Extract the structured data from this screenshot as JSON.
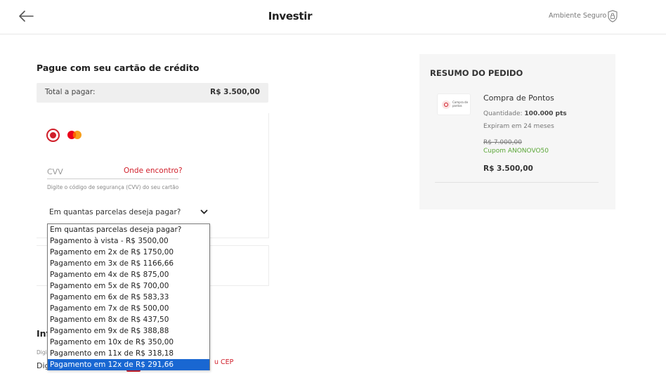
{
  "header": {
    "title": "Investir",
    "secure_label": "Ambiente Seguro",
    "back_icon": "arrow-left-icon",
    "lock_icon": "lock-icon"
  },
  "payment": {
    "title": "Pague com seu cartão de crédito",
    "total_label": "Total a pagar:",
    "total_value": "R$ 3.500,00",
    "card_brand": "mastercard-icon",
    "cvv_placeholder": "CVV",
    "cvv_help_link": "Onde encontro?",
    "cvv_hint": "Digite o código de segurança (CVV) do seu cartão",
    "installments_select_value": "Em quantas parcelas deseja pagar?",
    "installments_options": [
      "Em quantas parcelas deseja pagar?",
      "Pagamento à vista - R$ 3500,00",
      "Pagamento em 2x de R$ 1750,00",
      "Pagamento em 3x de R$ 1166,66",
      "Pagamento em 4x de R$ 875,00",
      "Pagamento em 5x de R$ 700,00",
      "Pagamento em 6x de R$ 583,33",
      "Pagamento em 7x de R$ 500,00",
      "Pagamento em 8x de R$ 437,50",
      "Pagamento em 9x de R$ 388,88",
      "Pagamento em 10x de R$ 350,00",
      "Pagamento em 11x de R$ 318,18",
      "Pagamento em 12x de R$ 291,66"
    ],
    "highlighted_option_index": 12
  },
  "info_section": {
    "heading": "Inf",
    "small_label": "Digi",
    "cep_value": "Dig",
    "cep_link": "u CEP"
  },
  "summary": {
    "title": "RESUMO DO PEDIDO",
    "thumb_text": "Compra de pontos",
    "product_name": "Compra de Pontos",
    "qty_label": "Quantidade:",
    "qty_value": "100.000 pts",
    "expire": "Expiram em 24 meses",
    "old_price": "R$ 7.000,00",
    "coupon": "Cupom ANONOVO50",
    "final_price": "R$ 3.500,00"
  },
  "colors": {
    "accent": "#d01f2a",
    "coupon_green": "#5aa637",
    "selection_blue": "#1967d2"
  }
}
